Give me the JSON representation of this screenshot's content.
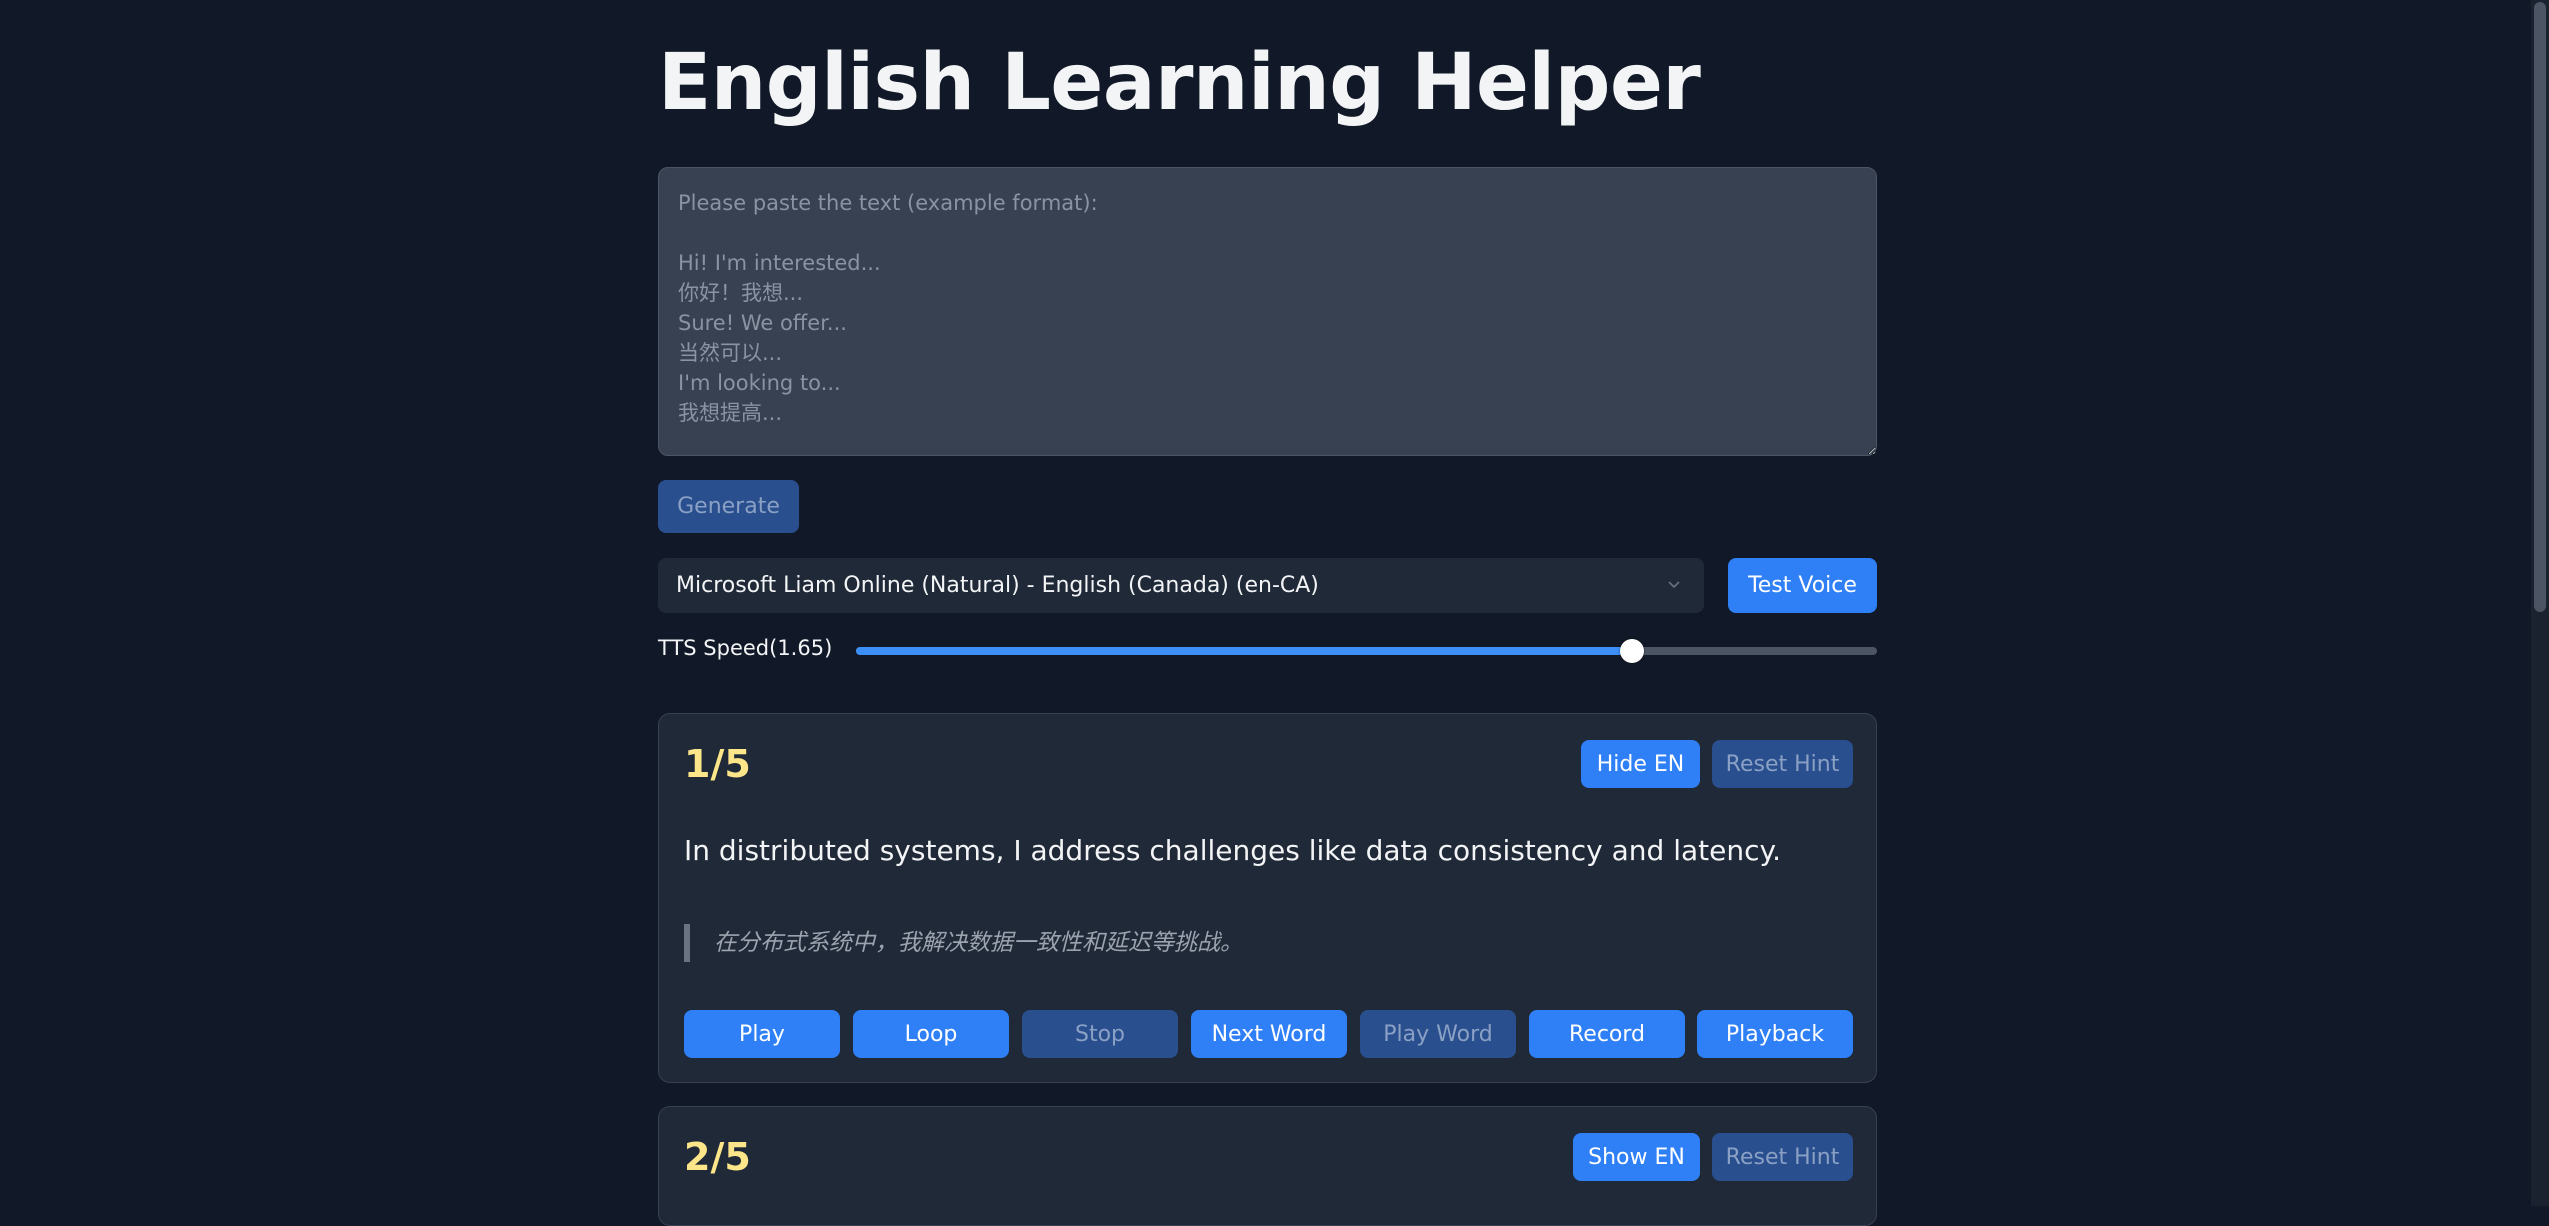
{
  "header": {
    "title": "English Learning Helper"
  },
  "input": {
    "placeholder": "Please paste the text (example format):\n\nHi! I'm interested...\n你好！我想...\nSure! We offer...\n当然可以...\nI'm looking to...\n我想提高...",
    "value": ""
  },
  "generate_button": {
    "label": "Generate",
    "disabled": true
  },
  "voice": {
    "selected": "Microsoft Liam Online (Natural) - English (Canada) (en-CA)",
    "test_label": "Test Voice"
  },
  "speed": {
    "label": "TTS Speed(1.65)",
    "value_fraction": 0.76
  },
  "cards": [
    {
      "counter": "1/5",
      "toggle_label": "Hide EN",
      "reset_label": "Reset Hint",
      "en": "In distributed systems, I address challenges like data consistency and latency.",
      "zh": "在分布式系统中，我解决数据一致性和延迟等挑战。",
      "actions": [
        {
          "label": "Play",
          "disabled": false
        },
        {
          "label": "Loop",
          "disabled": false
        },
        {
          "label": "Stop",
          "disabled": true
        },
        {
          "label": "Next Word",
          "disabled": false
        },
        {
          "label": "Play Word",
          "disabled": true
        },
        {
          "label": "Record",
          "disabled": false
        },
        {
          "label": "Playback",
          "disabled": false
        }
      ]
    },
    {
      "counter": "2/5",
      "toggle_label": "Show EN",
      "reset_label": "Reset Hint"
    }
  ],
  "colors": {
    "background": "#111827",
    "card": "#1f2937",
    "accent": "#2f80f6",
    "accent_disabled": "#2a4f8f",
    "counter": "#fde68a"
  },
  "icons": {
    "select_chevron": "chevron-down-icon"
  }
}
